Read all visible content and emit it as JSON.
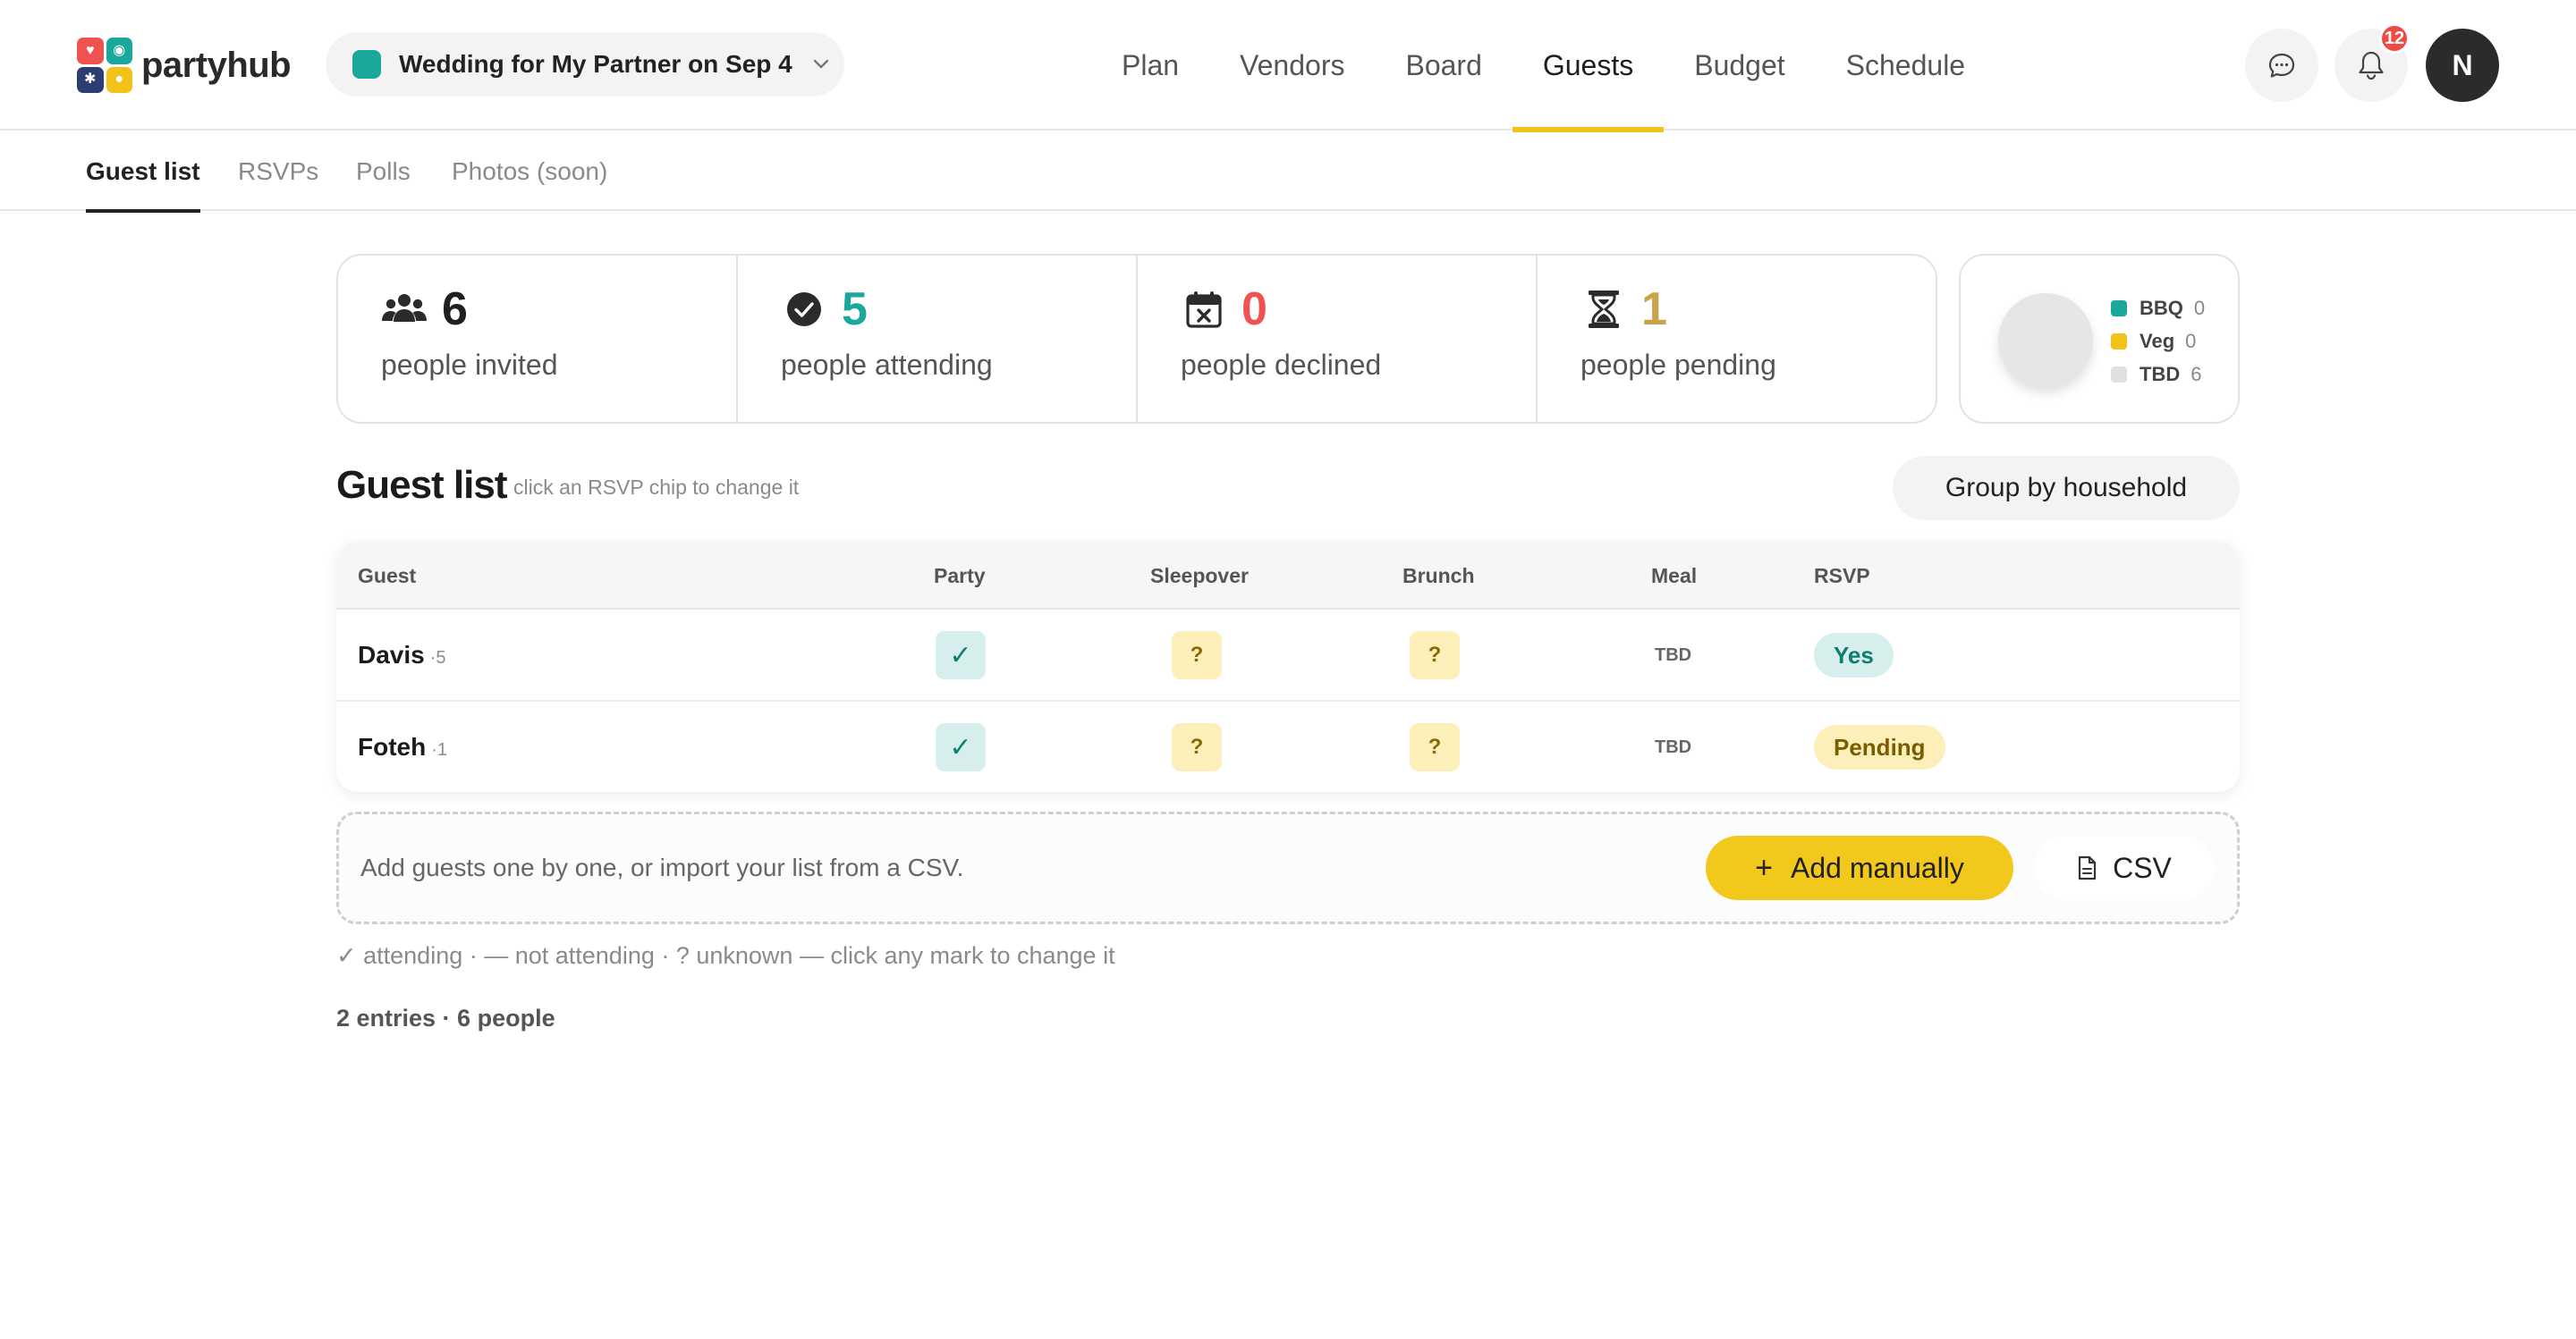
{
  "app": {
    "logo_text": "partyhub",
    "event_title": "Wedding for My Partner on Sep 4",
    "event_color": "#1ba89c",
    "notification_count": "12",
    "avatar_initial": "N"
  },
  "nav": {
    "items": [
      "Plan",
      "Vendors",
      "Board",
      "Guests",
      "Budget",
      "Schedule"
    ],
    "active": "Guests",
    "accent_color": "#f2c21b"
  },
  "subnav": {
    "items": [
      "Guest list",
      "RSVPs",
      "Polls",
      "Photos (soon)"
    ],
    "active": "Guest list"
  },
  "stats": [
    {
      "icon": "people-group-icon",
      "value": "6",
      "label": "people invited",
      "color": "#1f1f1f"
    },
    {
      "icon": "check-circle-icon",
      "value": "5",
      "label": "people attending",
      "color": "#1ba89c"
    },
    {
      "icon": "calendar-x-icon",
      "value": "0",
      "label": "people declined",
      "color": "#ef5350"
    },
    {
      "icon": "hourglass-icon",
      "value": "1",
      "label": "people pending",
      "color": "#c9a24a"
    }
  ],
  "meals": [
    {
      "name": "BBQ",
      "count": "0",
      "color": "#1ba89c"
    },
    {
      "name": "Veg",
      "count": "0",
      "color": "#f2c21b"
    },
    {
      "name": "TBD",
      "count": "6",
      "color": "#e0e0e0"
    }
  ],
  "guest_list": {
    "title": "Guest list",
    "hint": "click an RSVP chip to change it",
    "group_button": "Group by household",
    "columns": [
      "Guest",
      "Party",
      "Sleepover",
      "Brunch",
      "Meal",
      "RSVP"
    ],
    "rows": [
      {
        "name": "Davis",
        "count": "·5",
        "party": "✓",
        "sleepover": "?",
        "brunch": "?",
        "meal": "TBD",
        "rsvp": "Yes"
      },
      {
        "name": "Foteh",
        "count": "·1",
        "party": "✓",
        "sleepover": "?",
        "brunch": "?",
        "meal": "TBD",
        "rsvp": "Pending"
      }
    ]
  },
  "add": {
    "text": "Add guests one by one, or import your list from a CSV.",
    "add_button": "Add manually",
    "add_icon": "+",
    "csv_button": "CSV"
  },
  "legend_note": "✓ attending · — not attending · ? unknown — click any mark to change it",
  "summary": "2 entries · 6 people"
}
